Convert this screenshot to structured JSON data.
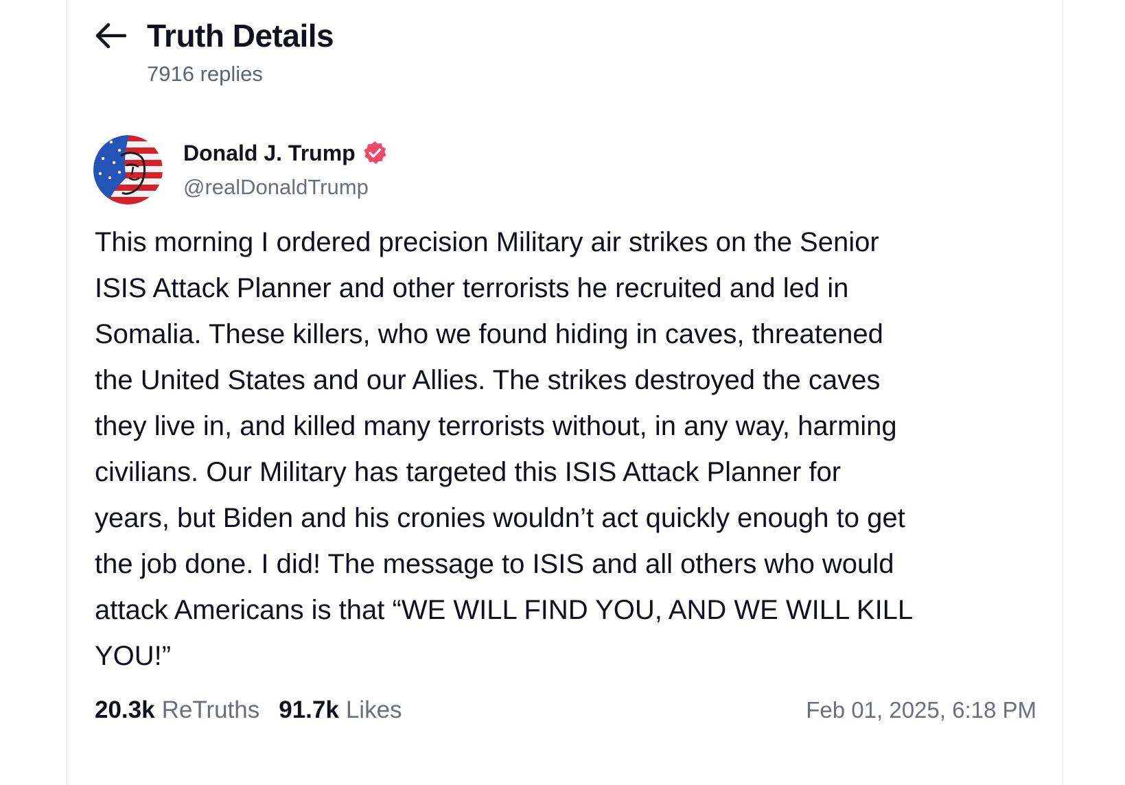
{
  "header": {
    "title": "Truth Details",
    "replies": "7916 replies",
    "back_icon": "arrow-left-icon"
  },
  "post": {
    "author_name": "Donald J. Trump",
    "handle": "@realDonaldTrump",
    "verified_icon": "verified-badge-icon",
    "verified_color": "#f0476a",
    "body": "This morning I ordered precision Military air strikes on the Senior\nISIS Attack Planner and other terrorists he recruited and led in\nSomalia. These killers, who we found hiding in caves, threatened\nthe United States and our Allies. The strikes destroyed the caves\nthey live in, and killed many terrorists without, in any way, harming\ncivilians. Our Military has targeted this ISIS Attack Planner for\nyears, but Biden and his cronies wouldn’t act quickly enough to get\nthe job done. I did! The message to ISIS and all others who would\nattack Americans is that “WE WILL FIND YOU, AND WE WILL KILL\nYOU!”",
    "retruths_count": "20.3k",
    "retruths_label": "ReTruths",
    "likes_count": "91.7k",
    "likes_label": "Likes",
    "timestamp": "Feb 01, 2025, 6:18 PM"
  }
}
